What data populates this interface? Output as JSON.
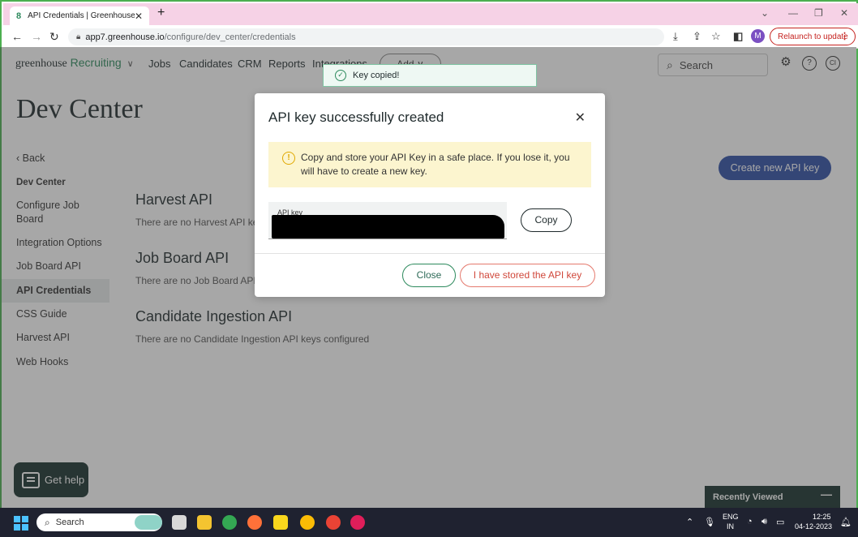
{
  "browser": {
    "tab_title": "API Credentials | Greenhouse",
    "favicon": "8",
    "url_host": "app7.greenhouse.io",
    "url_path": "/configure/dev_center/credentials",
    "profile_initial": "M",
    "relaunch_label": "Relaunch to update"
  },
  "topnav": {
    "brand_primary": "greenhouse",
    "brand_secondary": "Recruiting",
    "links": [
      "Jobs",
      "Candidates",
      "CRM",
      "Reports",
      "Integrations"
    ],
    "add_label": "Add",
    "search_placeholder": "Search",
    "user_initials": "CI"
  },
  "page": {
    "title": "Dev Center",
    "create_button": "Create new API key"
  },
  "sidebar": {
    "back": "Back",
    "section": "Dev Center",
    "items": [
      "Configure Job Board",
      "Integration Options",
      "Job Board API",
      "API Credentials",
      "CSS Guide",
      "Harvest API",
      "Web Hooks"
    ],
    "active": "API Credentials"
  },
  "sections": [
    {
      "title": "Harvest API",
      "subtitle": "There are no Harvest API keys configured"
    },
    {
      "title": "Job Board API",
      "subtitle": "There are no Job Board API keys configured"
    },
    {
      "title": "Candidate Ingestion API",
      "subtitle": "There are no Candidate Ingestion API keys configured"
    }
  ],
  "toast": {
    "message": "Key copied!"
  },
  "modal": {
    "title": "API key successfully created",
    "warning": "Copy and store your API Key in a safe place. If you lose it, you will have to create a new key.",
    "key_label": "API key",
    "copy_button": "Copy",
    "close_button": "Close",
    "confirm_button": "I have stored the API key"
  },
  "widgets": {
    "get_help": "Get help",
    "recently_viewed": "Recently Viewed"
  },
  "taskbar": {
    "search_placeholder": "Search",
    "language": "ENG",
    "region": "IN",
    "time": "12:25",
    "date": "04-12-2023"
  },
  "colors": {
    "brand_green": "#2d8a5d",
    "primary_blue": "#2f4fa6",
    "dark_green": "#17302c",
    "danger": "#d0473a"
  }
}
